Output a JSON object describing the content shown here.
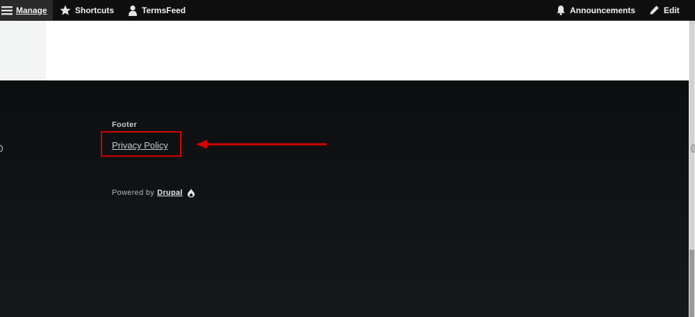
{
  "toolbar": {
    "manage_label": "Manage",
    "shortcuts_label": "Shortcuts",
    "user_label": "TermsFeed",
    "announcements_label": "Announcements",
    "edit_label": "Edit"
  },
  "footer": {
    "heading": "Footer",
    "links": [
      {
        "label": "Privacy Policy"
      }
    ],
    "powered_prefix": "Powered by",
    "powered_link": "Drupal"
  },
  "annotation": {
    "color": "#d40000"
  }
}
